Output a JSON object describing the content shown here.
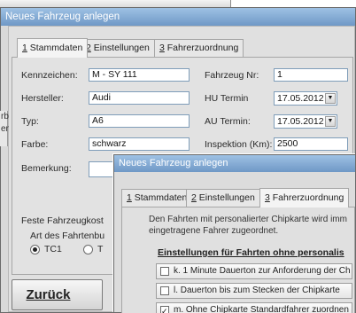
{
  "background": {
    "sidebar_items": [
      "rb",
      "en"
    ]
  },
  "dialog1": {
    "title": "Neues Fahrzeug anlegen",
    "tabs": [
      {
        "num": "1",
        "label": " Stammdaten"
      },
      {
        "num": "2",
        "label": " Einstellungen"
      },
      {
        "num": "3",
        "label": " Fahrerzuordnung"
      }
    ],
    "fields": {
      "kennzeichen_label": "Kennzeichen:",
      "kennzeichen_value": "M - SY 111",
      "hersteller_label": "Hersteller:",
      "hersteller_value": "Audi",
      "typ_label": "Typ:",
      "typ_value": "A6",
      "farbe_label": "Farbe:",
      "farbe_value": "schwarz",
      "bemerkung_label": "Bemerkung:",
      "fahrzeug_nr_label": "Fahrzeug Nr:",
      "fahrzeug_nr_value": "1",
      "hu_termin_label": "HU Termin",
      "hu_termin_value": "17.05.2012",
      "au_termin_label": "AU Termin:",
      "au_termin_value": "17.05.2012",
      "inspektion_label": "Inspektion (Km):",
      "inspektion_value": "2500"
    },
    "feste_kosten_label": "Feste Fahrzeugkost",
    "art_label": "Art des Fahrtenbu",
    "radio_tc1": "TC1",
    "radio_t": "T",
    "back_button": "Zurück"
  },
  "dialog2": {
    "title": "Neues Fahrzeug anlegen",
    "tabs": [
      {
        "num": "1",
        "label": " Stammdaten"
      },
      {
        "num": "2",
        "label": " Einstellungen"
      },
      {
        "num": "3",
        "label": " Fahrerzuordnung"
      }
    ],
    "info_line1": "Den Fahrten mit personalierter Chipkarte wird imm",
    "info_line2": "eingetragene Fahrer zugeordnet.",
    "section_title": "Einstellungen für Fahrten ohne personalis",
    "options": [
      {
        "label": "k. 1 Minute Dauerton zur Anforderung der Ch",
        "checked": false
      },
      {
        "label": "l. Dauerton bis zum Stecken der Chipkarte",
        "checked": false
      },
      {
        "label": "m. Ohne Chipkarte Standardfahrer zuordnen",
        "checked": true
      }
    ]
  }
}
